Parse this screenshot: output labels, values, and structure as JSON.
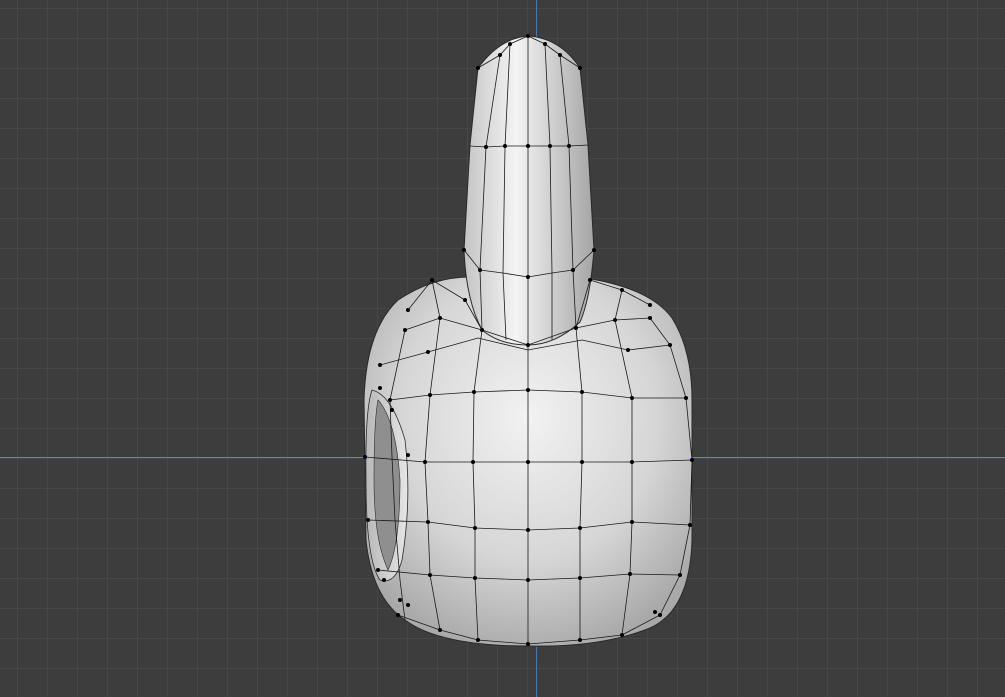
{
  "viewport": {
    "background_color": "#3d3d3d",
    "grid_color": "#474747",
    "x_axis_color": "#6f9a2a",
    "y_axis_color": "#4a78b0",
    "mesh_color": "#d9d9d9",
    "wire_color": "#1a1a1a",
    "vertex_color": "#000000"
  },
  "object": {
    "kind": "mesh",
    "mode": "edit",
    "shading": "solid"
  }
}
